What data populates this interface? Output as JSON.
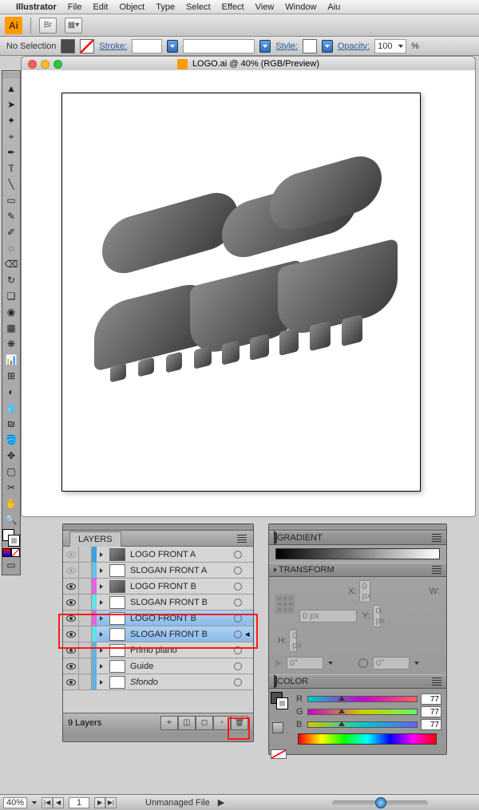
{
  "menubar": {
    "app_name": "Illustrator",
    "items": [
      "File",
      "Edit",
      "Object",
      "Type",
      "Select",
      "Effect",
      "View",
      "Window",
      "Aiu"
    ]
  },
  "appbar": {
    "logo": "Ai",
    "br_button": "Br"
  },
  "options": {
    "selection": "No Selection",
    "stroke_label": "Stroke:",
    "stroke_weight": "",
    "style_label": "Style:",
    "opacity_label": "Opacity:",
    "opacity_value": "100",
    "opacity_unit": "%"
  },
  "document": {
    "title": "LOGO.ai @ 40% (RGB/Preview)"
  },
  "tools": [
    "▲",
    "➤",
    "✦",
    "⌖",
    "T",
    "╲",
    "▭",
    "✎",
    "✐",
    "◌",
    "✂",
    "↻",
    "❏",
    "▦",
    "⊞",
    "📊",
    "◐",
    "₪",
    "✥",
    "✋",
    "🔍"
  ],
  "layers_panel": {
    "title": "LAYERS",
    "rows": [
      {
        "color": "#3fa0e0",
        "visible": false,
        "thumb": "art",
        "name": "LOGO FRONT A",
        "italic": false,
        "selected": false
      },
      {
        "color": "#66c2e8",
        "visible": false,
        "thumb": "empty",
        "name": "SLOGAN FRONT A",
        "italic": false,
        "selected": false
      },
      {
        "color": "#e066e0",
        "visible": true,
        "thumb": "art",
        "name": "LOGO FRONT B",
        "italic": false,
        "selected": false
      },
      {
        "color": "#66e0e0",
        "visible": true,
        "thumb": "empty",
        "name": "SLOGAN FRONT B",
        "italic": false,
        "selected": false
      },
      {
        "color": "#e066e0",
        "visible": true,
        "thumb": "empty",
        "name": "LOGO FRONT B",
        "italic": false,
        "selected": true
      },
      {
        "color": "#66e0e0",
        "visible": true,
        "thumb": "empty",
        "name": "SLOGAN FRONT B",
        "italic": false,
        "selected": true
      },
      {
        "color": "#66b0e0",
        "visible": true,
        "thumb": "empty",
        "name": "Primo piano",
        "italic": false,
        "selected": false
      },
      {
        "color": "#66b0e0",
        "visible": true,
        "thumb": "empty",
        "name": "Guide",
        "italic": false,
        "selected": false
      },
      {
        "color": "#66b0e0",
        "visible": true,
        "thumb": "empty",
        "name": "Sfondo",
        "italic": true,
        "selected": false
      }
    ],
    "footer_count": "9 Layers"
  },
  "right_panel": {
    "gradient_title": "GRADIENT",
    "transform_title": "TRANSFORM",
    "transform": {
      "x_label": "X:",
      "x_val": "0 px",
      "y_label": "Y:",
      "y_val": "0 px",
      "w_label": "W:",
      "w_val": "0 px",
      "h_label": "H:",
      "h_val": "0 px",
      "angle": "0°",
      "shear": "0°"
    },
    "color_title": "COLOR",
    "color": {
      "r": "77",
      "g": "77",
      "b": "77",
      "labels": [
        "R",
        "G",
        "B"
      ]
    }
  },
  "status": {
    "zoom": "40%",
    "artboard": "1",
    "doc_status": "Unmanaged File"
  }
}
